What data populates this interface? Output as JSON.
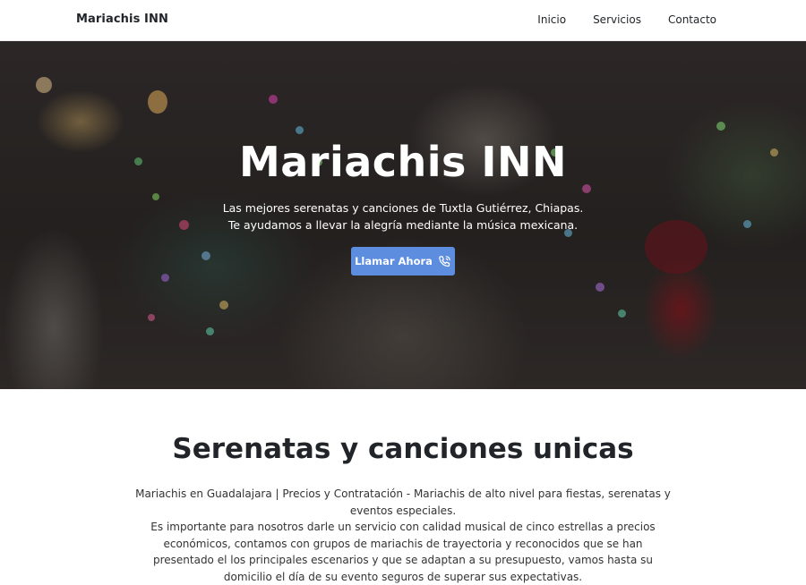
{
  "nav": {
    "brand": "Mariachis INN",
    "links": [
      "Inicio",
      "Servicios",
      "Contacto"
    ]
  },
  "hero": {
    "title": "Mariachis INN",
    "subtitle_line1": "Las mejores serenatas y canciones de Tuxtla Gutiérrez, Chiapas.",
    "subtitle_line2": "Te ayudamos a llevar la alegría mediante la música mexicana.",
    "cta_label": "Llamar Ahora",
    "cta_icon": "phone-call-icon",
    "cta_color": "#5c8ddf"
  },
  "section": {
    "title": "Serenatas y canciones unicas",
    "paragraph1": "Mariachis en Guadalajara | Precios y Contratación - Mariachis de alto nivel para fiestas, serenatas y eventos especiales.",
    "paragraph2": "Es importante para nosotros darle un servicio con calidad musical de cinco estrellas a precios económicos, contamos con grupos de mariachis de trayectoria y reconocidos que se han presentado el los principales escenarios y que se adaptan a su presupuesto, vamos hasta su domicilio el día de su evento seguros de superar sus expectativas."
  }
}
